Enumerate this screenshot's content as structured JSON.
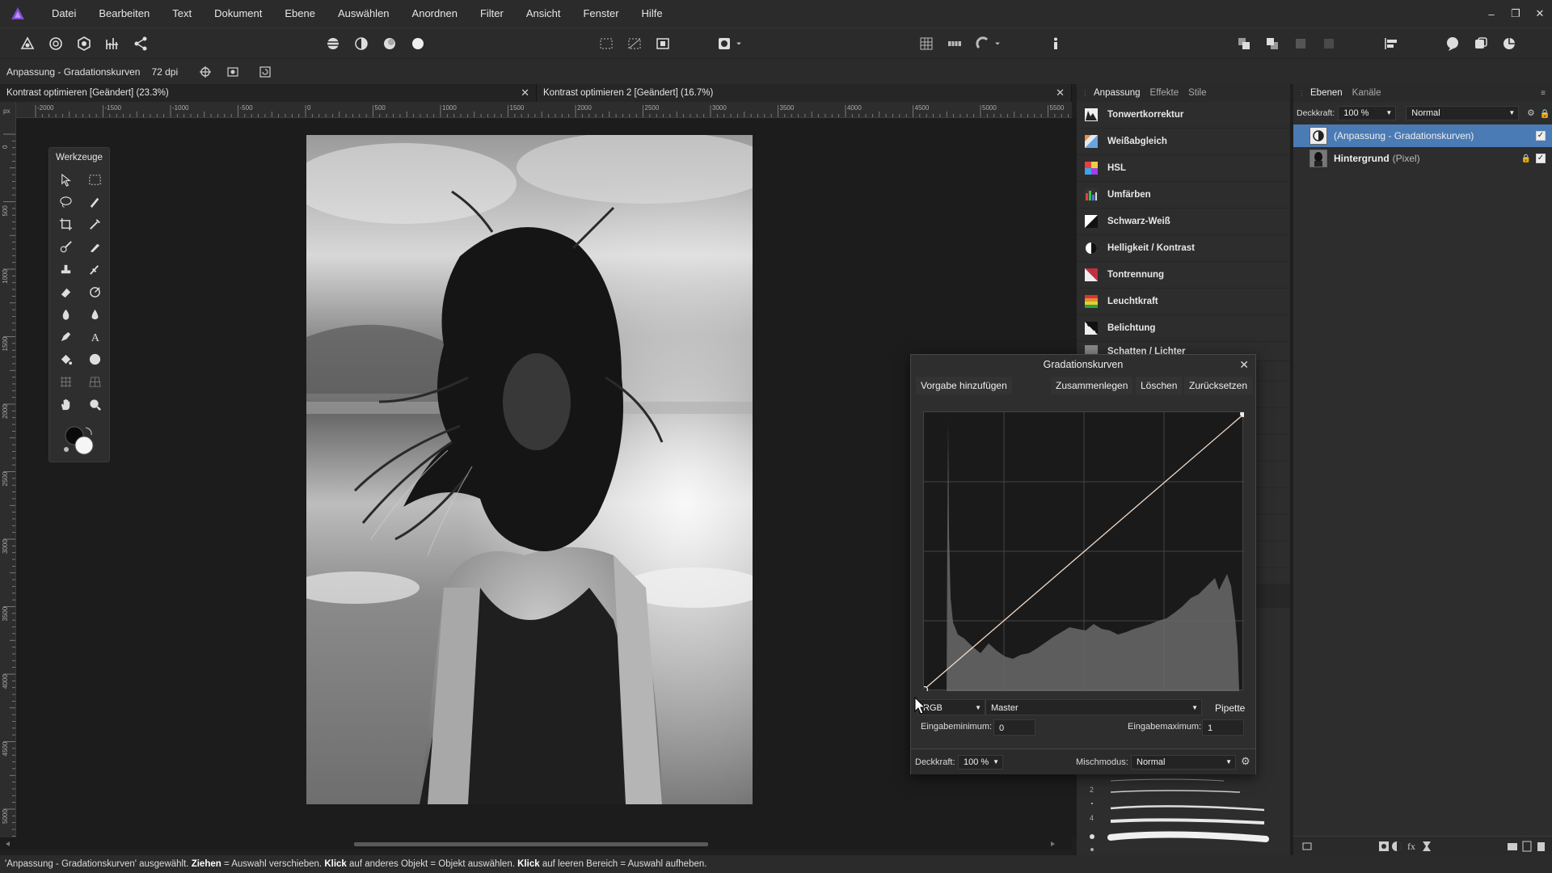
{
  "menubar": {
    "items": [
      "Datei",
      "Bearbeiten",
      "Text",
      "Dokument",
      "Ebene",
      "Auswählen",
      "Anordnen",
      "Filter",
      "Ansicht",
      "Fenster",
      "Hilfe"
    ],
    "window_controls": [
      "–",
      "❐",
      "✕"
    ]
  },
  "context": {
    "label": "Anpassung - Gradationskurven",
    "dpi": "72 dpi"
  },
  "tabs": [
    {
      "label": "Kontrast optimieren [Geändert] (23.3%)"
    },
    {
      "label": "Kontrast optimieren 2 [Geändert] (16.7%)"
    }
  ],
  "ruler": {
    "unit": "px",
    "h_ticks": [
      "-2000",
      "-1500",
      "-1000",
      "-500",
      "0",
      "500",
      "1000",
      "1500",
      "2000",
      "2500",
      "3000",
      "3500",
      "4000",
      "4500",
      "5000",
      "5500"
    ],
    "v_ticks": [
      "0",
      "500",
      "1000",
      "1500",
      "2000",
      "2500",
      "3000",
      "3500",
      "4000",
      "4500",
      "5000"
    ]
  },
  "tools_panel": {
    "title": "Werkzeuge"
  },
  "adjustment_panel": {
    "tabs": [
      "Anpassung",
      "Effekte",
      "Stile"
    ],
    "items": [
      "Tonwertkorrektur",
      "Weißabgleich",
      "HSL",
      "Umfärben",
      "Schwarz-Weiß",
      "Helligkeit / Kontrast",
      "Tontrennung",
      "Leuchtkraft",
      "Belichtung",
      "Schatten / Lichter"
    ]
  },
  "layers_panel": {
    "tabs": [
      "Ebenen",
      "Kanäle"
    ],
    "opacity_label": "Deckkraft:",
    "opacity_value": "100 %",
    "blend_mode": "Normal",
    "layers": [
      {
        "name": "(Anpassung - Gradationskurven)",
        "type": "",
        "selected": true
      },
      {
        "name": "Hintergrund",
        "type": "(Pixel)",
        "selected": false
      }
    ]
  },
  "curves_dialog": {
    "title": "Gradationskurven",
    "buttons": [
      "Vorgabe hinzufügen",
      "Zusammenlegen",
      "Löschen",
      "Zurücksetzen"
    ],
    "channel": "RGB",
    "curve_target": "Master",
    "pipette_label": "Pipette",
    "input_min_label": "Eingabeminimum:",
    "input_min_value": "0",
    "input_max_label": "Eingabemaximum:",
    "input_max_value": "1",
    "opacity_label": "Deckkraft:",
    "opacity_value": "100 %",
    "blend_label": "Mischmodus:",
    "blend_value": "Normal"
  },
  "brush_sizes": [
    "2",
    "4"
  ],
  "status": {
    "quoted": "'Anpassung - Gradationskurven' ausgewählt.",
    "k1": "Ziehen",
    "t1": "= Auswahl verschieben.",
    "k2": "Klick",
    "t2": "auf anderes Objekt = Objekt auswählen.",
    "k3": "Klick",
    "t3": "auf leeren Bereich = Auswahl aufheben."
  },
  "colors": {
    "accent": "#4a7bb5",
    "app_purple": "#7b4fd6",
    "panel_bg": "#2d2d2d"
  }
}
